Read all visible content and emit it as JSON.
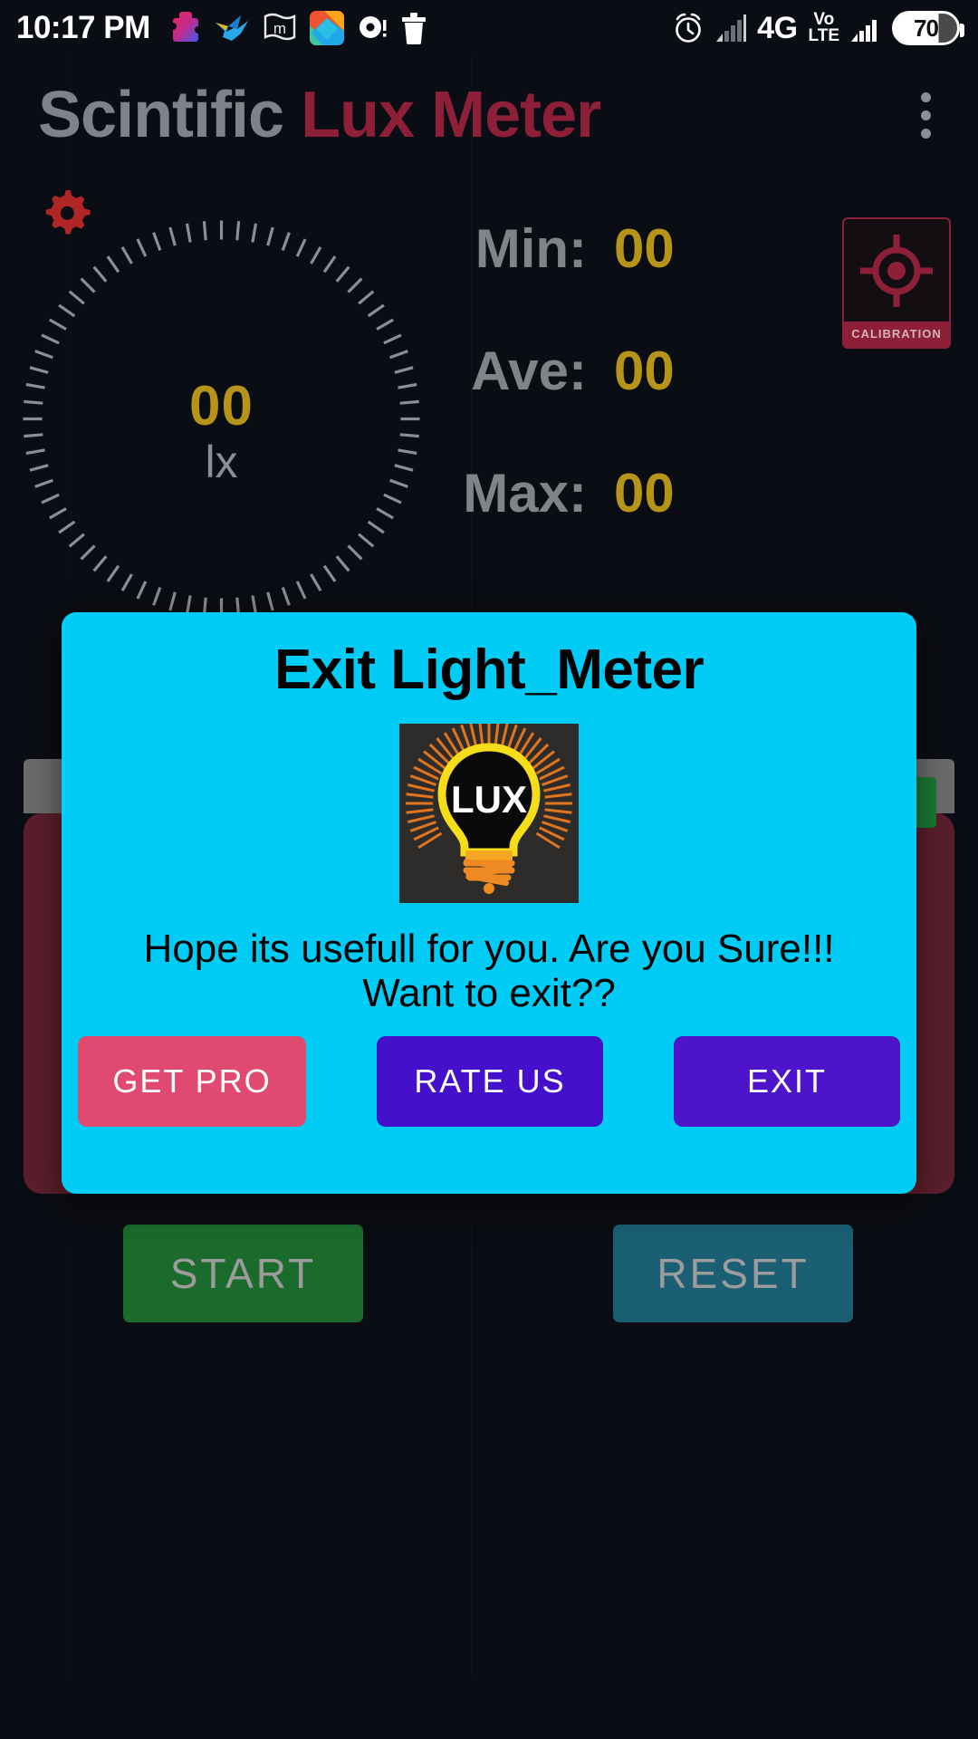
{
  "status_bar": {
    "time": "10:17 PM",
    "left_icons": [
      "puzzle-piece-icon",
      "hummingbird-icon",
      "mastodon-flag-icon",
      "gallery-icon",
      "recorder-icon",
      "trash-icon"
    ],
    "right_icons": [
      "alarm-icon",
      "signal-bars-icon",
      "signal-bars-2-icon"
    ],
    "network": "4G",
    "volte_top": "Vo",
    "volte_bottom": "LTE",
    "battery_level": "70"
  },
  "app_bar": {
    "title_part1": "Scintific",
    "title_part2": "Lux Meter",
    "overflow_icon": "overflow-menu-icon",
    "title_color_1": "#7e8289",
    "title_color_2": "#8d2038"
  },
  "gauge": {
    "value": "00",
    "unit": "lx",
    "value_color": "#b59419",
    "settings_icon": "gear-icon",
    "settings_color": "#b02626"
  },
  "stats": [
    {
      "label": "Min:",
      "value": "00"
    },
    {
      "label": "Ave:",
      "value": "00"
    },
    {
      "label": "Max:",
      "value": "00"
    }
  ],
  "calibration": {
    "label": "CALIBRATION",
    "icon": "crosshair-target-icon",
    "color": "#8d2038"
  },
  "controls": {
    "start_label": "START",
    "reset_label": "RESET",
    "start_color": "#1b6b2c",
    "reset_color": "#1a5f73"
  },
  "dialog": {
    "title": "Exit Light_Meter",
    "logo_icon": "lux-lightbulb-logo",
    "logo_text": "LUX",
    "message_line1": "Hope its usefull for you. Are you Sure!!!",
    "message_line2": "Want to exit??",
    "background_color": "#00ccf5",
    "buttons": [
      {
        "label": "GET PRO",
        "color": "#e04a70"
      },
      {
        "label": "RATE US",
        "color": "#4510cc"
      },
      {
        "label": "EXIT",
        "color": "#4d14cc"
      }
    ]
  }
}
